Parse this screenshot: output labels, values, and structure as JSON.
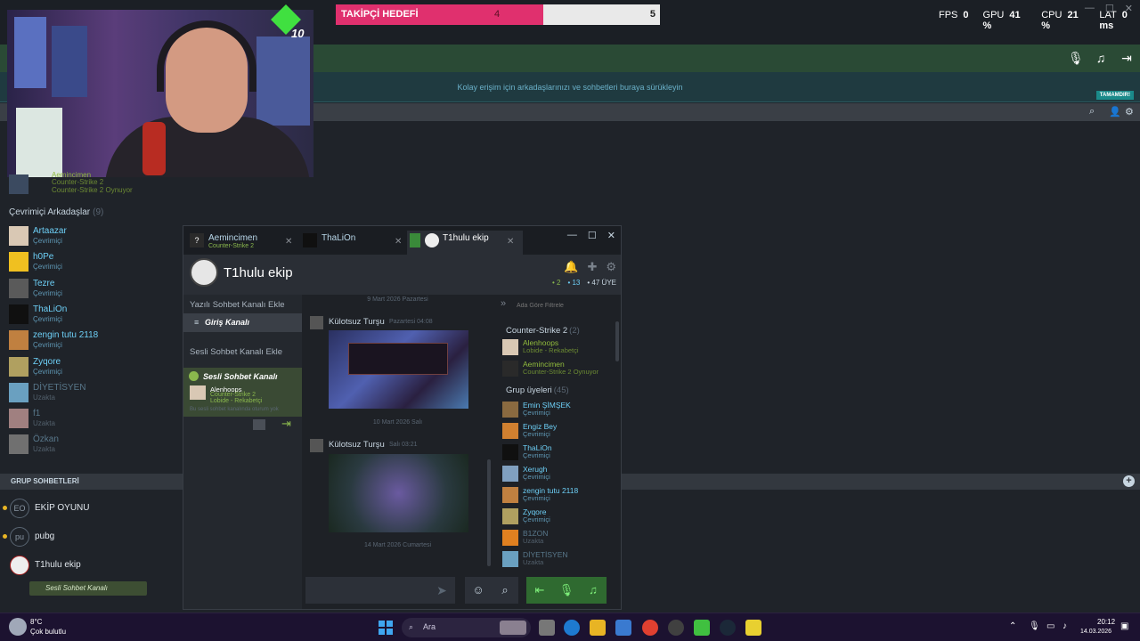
{
  "top": {
    "follower_goal": {
      "label": "TAKİPÇİ HEDEFİ",
      "current": "4",
      "target": "5",
      "progress": 0.8
    },
    "stats": [
      {
        "label": "FPS",
        "value": "0"
      },
      {
        "label": "GPU",
        "value": "41 %"
      },
      {
        "label": "CPU",
        "value": "21 %"
      },
      {
        "label": "LAT",
        "value": "0 ms"
      }
    ],
    "gem_count": "10"
  },
  "friends": {
    "dropzone_text": "Kolay erişim için arkadaşlarınızı ve sohbetleri buraya sürükleyin",
    "done_label": "TAMAMDIR!",
    "partial_friend": {
      "name": "Aemincimen",
      "game": "Counter-Strike 2",
      "status": "Counter-Strike 2 Oynuyor"
    },
    "online_title": "Çevrimiçi Arkadaşlar",
    "online_count": "(9)",
    "list": [
      {
        "name": "Artaazar",
        "status": "Çevrimiçi",
        "state": "online",
        "color": "#d9c8b4"
      },
      {
        "name": "h0Pe",
        "status": "Çevrimiçi",
        "state": "online",
        "color": "#f0c020"
      },
      {
        "name": "Tezre",
        "status": "Çevrimiçi",
        "state": "online",
        "color": "#5a5a5a"
      },
      {
        "name": "ThaLiOn",
        "status": "Çevrimiçi",
        "state": "online",
        "color": "#101010"
      },
      {
        "name": "zengin tutu 2118",
        "status": "Çevrimiçi",
        "state": "online",
        "color": "#c08040"
      },
      {
        "name": "Zyqore",
        "status": "Çevrimiçi",
        "state": "online",
        "color": "#b0a060"
      },
      {
        "name": "DİYETİSYEN",
        "status": "Uzakta",
        "state": "away",
        "color": "#6aa0c0"
      },
      {
        "name": "f1",
        "status": "Uzakta",
        "state": "away",
        "color": "#a08080"
      },
      {
        "name": "Özkan",
        "status": "Uzakta",
        "state": "away",
        "color": "#707070"
      }
    ]
  },
  "group_chats": {
    "title": "GRUP SOHBETLERİ",
    "items": [
      {
        "abbr": "EO",
        "name": "EKİP OYUNU"
      },
      {
        "abbr": "pu",
        "name": "pubg"
      },
      {
        "abbr": "",
        "name": "T1hulu ekip"
      }
    ],
    "voice_pill": "Sesli Sohbet Kanalı"
  },
  "chat": {
    "tabs": [
      {
        "name": "Aemincimen",
        "sub": "Counter-Strike 2"
      },
      {
        "name": "ThaLiOn",
        "sub": ""
      },
      {
        "name": "T1hulu ekip",
        "sub": ""
      }
    ],
    "title": "T1hulu ekip",
    "counts": {
      "in_game": "2",
      "online": "13",
      "members": "47 ÜYE"
    },
    "text_channels_header": "Yazılı Sohbet Kanalı Ekle",
    "text_channel": "Giriş Kanalı",
    "voice_channels_header": "Sesli Sohbet Kanalı Ekle",
    "voice_channel": {
      "name": "Sesli Sohbet Kanalı",
      "user": "Alenhoops",
      "game": "Counter-Strike 2",
      "lobby": "Lobide - Rekabetçi",
      "hint": "Bu sesli sohbet kanalında oturum yok"
    },
    "messages": [
      {
        "date_before": "9 Mart 2026 Pazartesi",
        "author": "Külotsuz Turşu",
        "time": "Pazartesi 04:08"
      },
      {
        "date_before": "10 Mart 2026 Salı",
        "author": "Külotsuz Turşu",
        "time": "Salı 03:21"
      }
    ],
    "date_after": "14 Mart 2026 Cumartesi",
    "member_search_placeholder": "Ada Göre Filtrele",
    "members": {
      "game_group": "Counter-Strike 2",
      "game_count": "(2)",
      "in_game": [
        {
          "name": "Alenhoops",
          "status": "Lobide - Rekabetçi",
          "color": "#d9c8b4"
        },
        {
          "name": "Aemincimen",
          "status": "Counter-Strike 2 Oynuyor",
          "color": "#2a2a2a"
        }
      ],
      "group_title": "Grup üyeleri",
      "group_count": "(45)",
      "list": [
        {
          "name": "Emin ŞİMŞEK",
          "status": "Çevrimiçi",
          "state": "online",
          "color": "#8a6a40"
        },
        {
          "name": "Engiz Bey",
          "status": "Çevrimiçi",
          "state": "online",
          "color": "#d08030"
        },
        {
          "name": "ThaLiOn",
          "status": "Çevrimiçi",
          "state": "online",
          "color": "#101010"
        },
        {
          "name": "Xerugh",
          "status": "Çevrimiçi",
          "state": "online",
          "color": "#80a0c0"
        },
        {
          "name": "zengin tutu 2118",
          "status": "Çevrimiçi",
          "state": "online",
          "color": "#c08040"
        },
        {
          "name": "Zyqore",
          "status": "Çevrimiçi",
          "state": "online",
          "color": "#b0a060"
        },
        {
          "name": "B1ZON",
          "status": "Uzakta",
          "state": "away",
          "color": "#e08020"
        },
        {
          "name": "DİYETİSYEN",
          "status": "Uzakta",
          "state": "away",
          "color": "#6aa0c0"
        }
      ]
    }
  },
  "taskbar": {
    "temp": "8°C",
    "weather": "Çok bulutlu",
    "search": "Ara",
    "time": "20:12",
    "date": "14.03.2026"
  }
}
